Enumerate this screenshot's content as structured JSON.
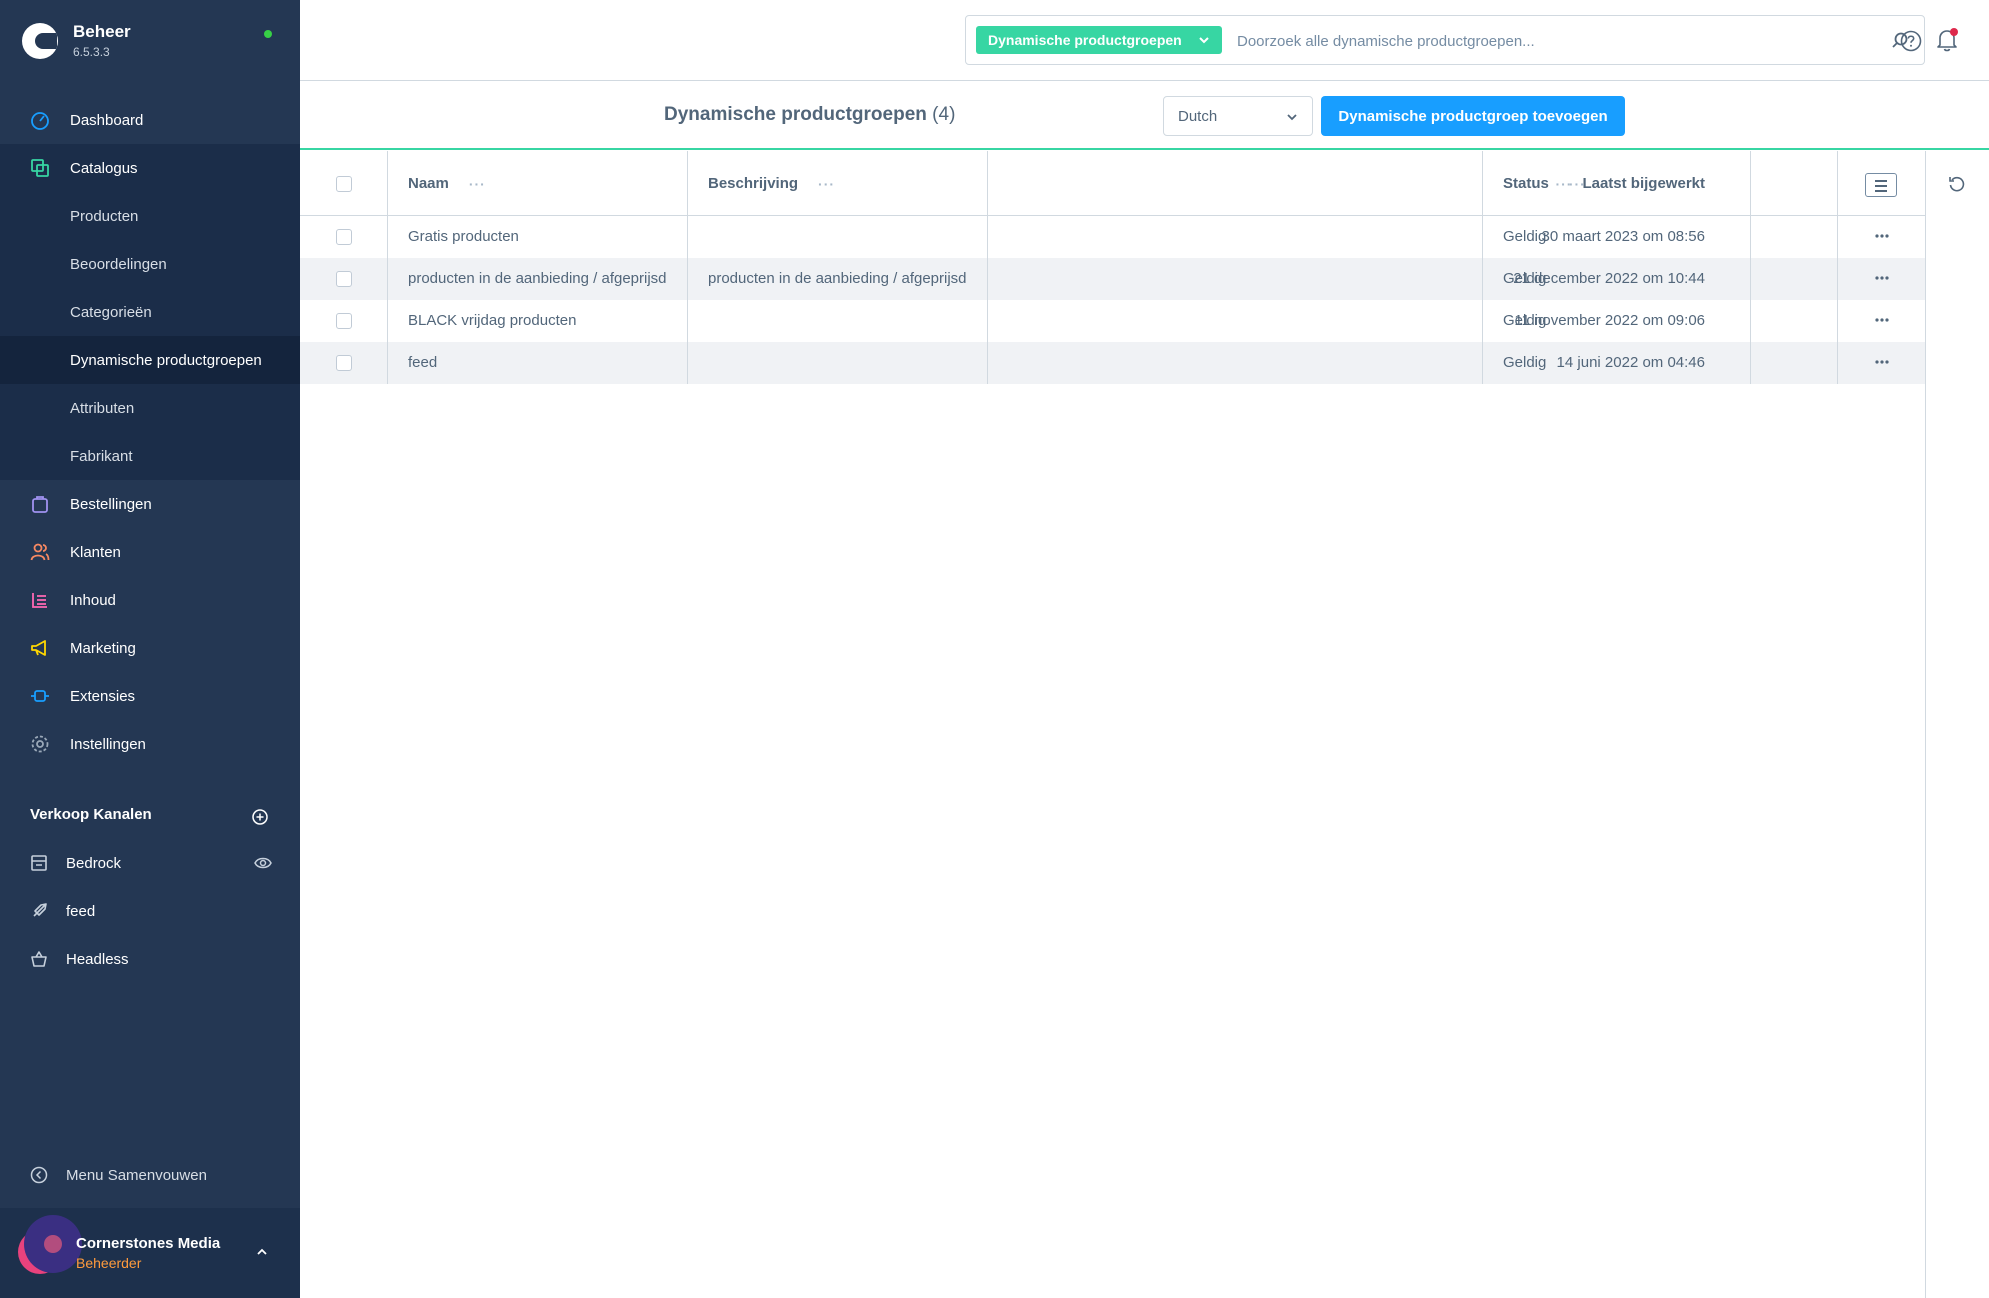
{
  "brand": {
    "title": "Beheer",
    "version": "6.5.3.3"
  },
  "nav": {
    "dashboard": "Dashboard",
    "catalogus": "Catalogus",
    "catalogus_items": [
      "Producten",
      "Beoordelingen",
      "Categorieën",
      "Dynamische productgroepen",
      "Attributen",
      "Fabrikant"
    ],
    "bestellingen": "Bestellingen",
    "klanten": "Klanten",
    "inhoud": "Inhoud",
    "marketing": "Marketing",
    "extensies": "Extensies",
    "instellingen": "Instellingen"
  },
  "channels": {
    "title": "Verkoop Kanalen",
    "items": [
      "Bedrock",
      "feed",
      "Headless"
    ]
  },
  "collapse_label": "Menu Samenvouwen",
  "user": {
    "name": "Cornerstones Media",
    "role": "Beheerder"
  },
  "search": {
    "type_label": "Dynamische productgroepen",
    "placeholder": "Doorzoek alle dynamische productgroepen..."
  },
  "page": {
    "title": "Dynamische productgroepen",
    "count": "(4)",
    "language": "Dutch",
    "add_button": "Dynamische productgroep toevoegen"
  },
  "grid": {
    "columns": {
      "name": "Naam",
      "description": "Beschrijving",
      "updated": "Laatst bijgewerkt",
      "status": "Status"
    },
    "rows": [
      {
        "name": "Gratis producten",
        "description": "",
        "updated": "30 maart 2023 om 08:56",
        "status": "Geldig"
      },
      {
        "name": "producten in de aanbieding / afgeprijsd",
        "description": "producten in de aanbieding / afgeprijsd",
        "updated": "21 december 2022 om 10:44",
        "status": "Geldig"
      },
      {
        "name": "BLACK vrijdag producten",
        "description": "",
        "updated": "11 november 2022 om 09:06",
        "status": "Geldig"
      },
      {
        "name": "feed",
        "description": "",
        "updated": "14 juni 2022 om 04:46",
        "status": "Geldig"
      }
    ]
  },
  "colors": {
    "sidebar": "#243753",
    "accent_green": "#37d6a3",
    "primary_blue": "#189eff",
    "role_orange": "#ff9b3d"
  },
  "icons": {
    "nav": [
      "dashboard-icon",
      "catalogus-icon",
      "bestellingen-icon",
      "klanten-icon",
      "inhoud-icon",
      "marketing-icon",
      "extensies-icon",
      "instellingen-icon"
    ],
    "top": [
      "search-icon",
      "help-icon",
      "bell-icon"
    ]
  }
}
